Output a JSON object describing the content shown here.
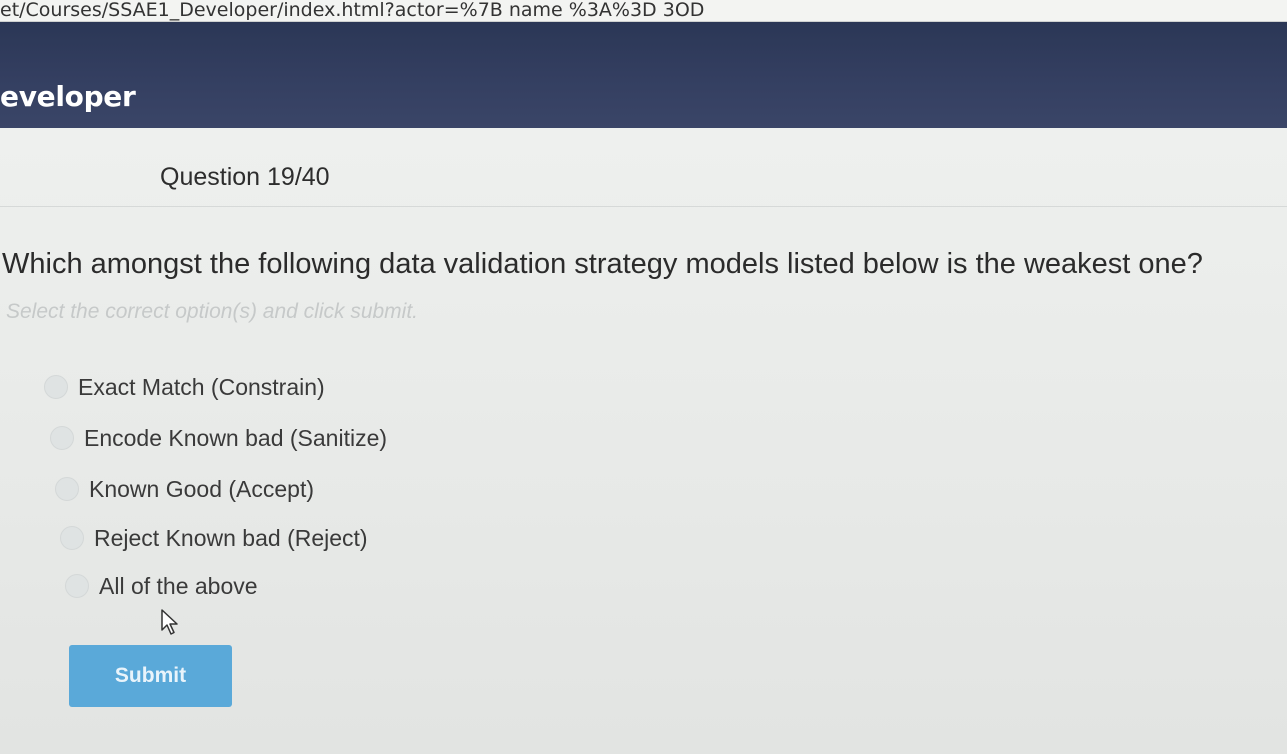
{
  "browser": {
    "url": "et/Courses/SSAE1_Developer/index.html?actor=%7B name %3A%3D 3OD"
  },
  "header": {
    "title": "eveloper"
  },
  "quiz": {
    "counter": "Question 19/40",
    "question": "Which amongst the following data validation strategy models listed below is the weakest one?",
    "instruction": "Select the correct option(s) and click submit.",
    "options": [
      {
        "label": "Exact Match (Constrain)"
      },
      {
        "label": "Encode Known bad (Sanitize)"
      },
      {
        "label": "Known Good (Accept)"
      },
      {
        "label": "Reject Known bad (Reject)"
      },
      {
        "label": "All of the above"
      }
    ],
    "submit_label": "Submit"
  },
  "colors": {
    "header_bg": "#343f61",
    "submit_bg": "#5aa9d9",
    "page_bg": "#e9ebe9"
  },
  "icons": {
    "cursor": "mouse-pointer-icon"
  }
}
